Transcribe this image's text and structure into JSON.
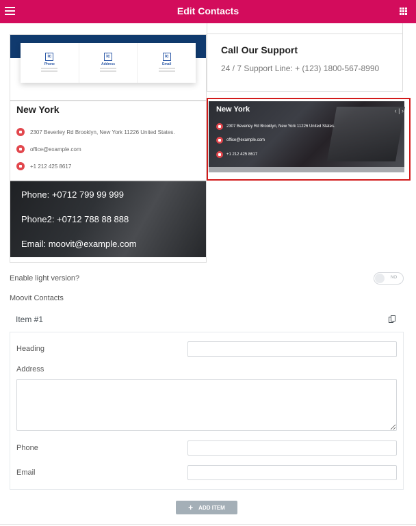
{
  "header": {
    "title": "Edit Contacts",
    "menu_icon": "hamburger-icon",
    "apps_icon": "grid-icon"
  },
  "accent": "#d30c5c",
  "preview_cards": {
    "card1": {
      "cols": [
        {
          "icon": "ic",
          "label": "Phone"
        },
        {
          "icon": "ic",
          "label": "Address"
        },
        {
          "icon": "ic",
          "label": "Email"
        }
      ]
    },
    "support": {
      "heading": "Call Our Support",
      "line": "24 / 7 Support Line: + (123) 1800-567-8990"
    },
    "newyork_light": {
      "heading": "New York",
      "address": "2307 Beverley Rd Brooklyn, New York 11226 United States.",
      "email": "office@example.com",
      "phone": "+1 212 425 8617"
    },
    "newyork_dark": {
      "heading": "New York",
      "address": "2307 Beverley Rd Brooklyn, New York 11226 United States.",
      "email": "office@example.com",
      "phone": "+1 212 425 8617",
      "nav": "‹ | ›"
    },
    "phone_card": {
      "phone": "Phone: +0712 799 99 999",
      "phone2": "Phone2: +0712 788 88 888",
      "email": "Email: moovit@example.com"
    }
  },
  "settings": {
    "light_label": "Enable light version?",
    "toggle_text": "NO",
    "section_label": "Moovit Contacts"
  },
  "item": {
    "title": "Item #1",
    "fields": {
      "heading_label": "Heading",
      "heading_value": "",
      "address_label": "Address",
      "address_value": "",
      "phone_label": "Phone",
      "phone_value": "",
      "email_label": "Email",
      "email_value": ""
    }
  },
  "add_item": {
    "label": "ADD ITEM"
  }
}
